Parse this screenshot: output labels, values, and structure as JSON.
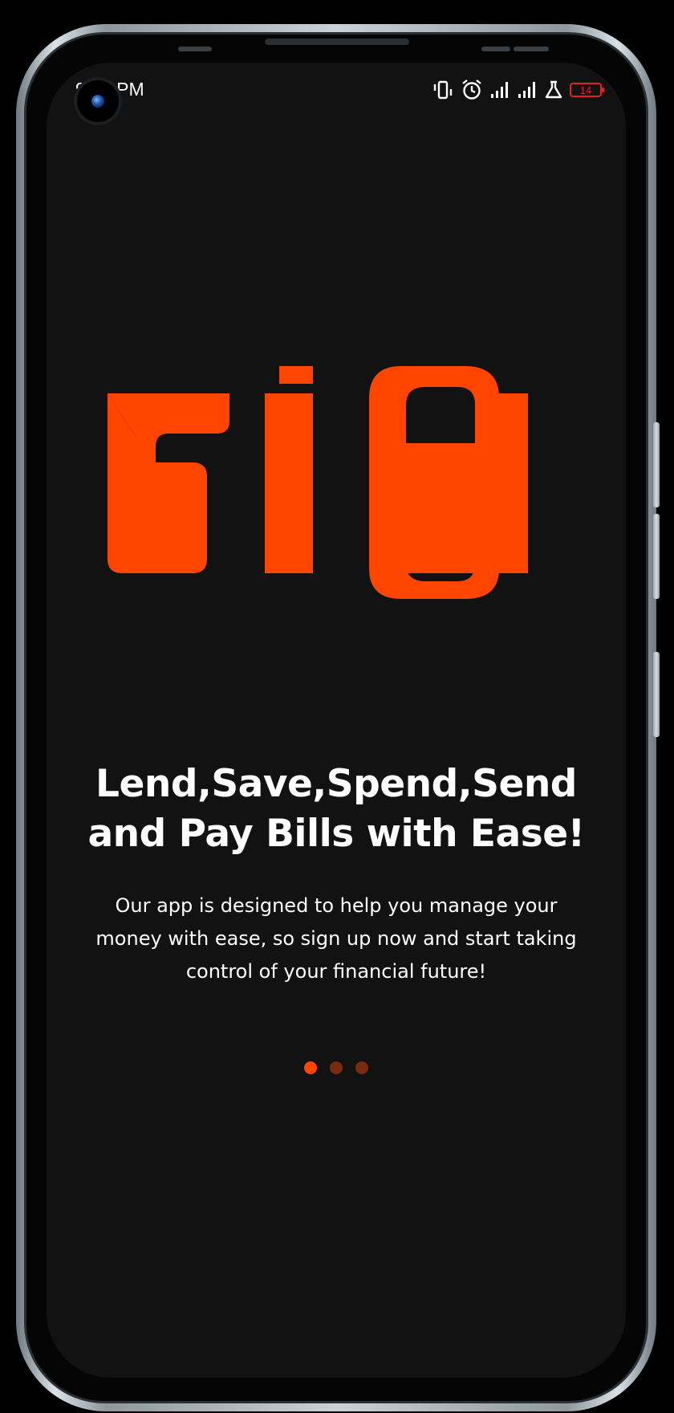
{
  "status_bar": {
    "time": "9:41 PM",
    "battery_level": "14",
    "icons": [
      "vibrate-icon",
      "alarm-icon",
      "signal-icon",
      "signal-icon",
      "lab-flask-icon",
      "battery-icon"
    ]
  },
  "colors": {
    "brand": "#FF4500",
    "background": "#121212",
    "text": "#FFFFFF",
    "dot_inactive": "#7A2A10",
    "battery_low": "#E02323"
  },
  "hero": {
    "logo_icon": "brand-logo"
  },
  "onboarding": {
    "headline_line1": "Lend,Save,Spend,Send",
    "headline_line2": "and Pay Bills with Ease!",
    "body_line1": "Our app is designed to help you manage your",
    "body_line2": "money with ease, so sign up now and start taking",
    "body_line3": "control of your financial future!"
  },
  "pager": {
    "total_pages": 3,
    "current_page": 1
  }
}
